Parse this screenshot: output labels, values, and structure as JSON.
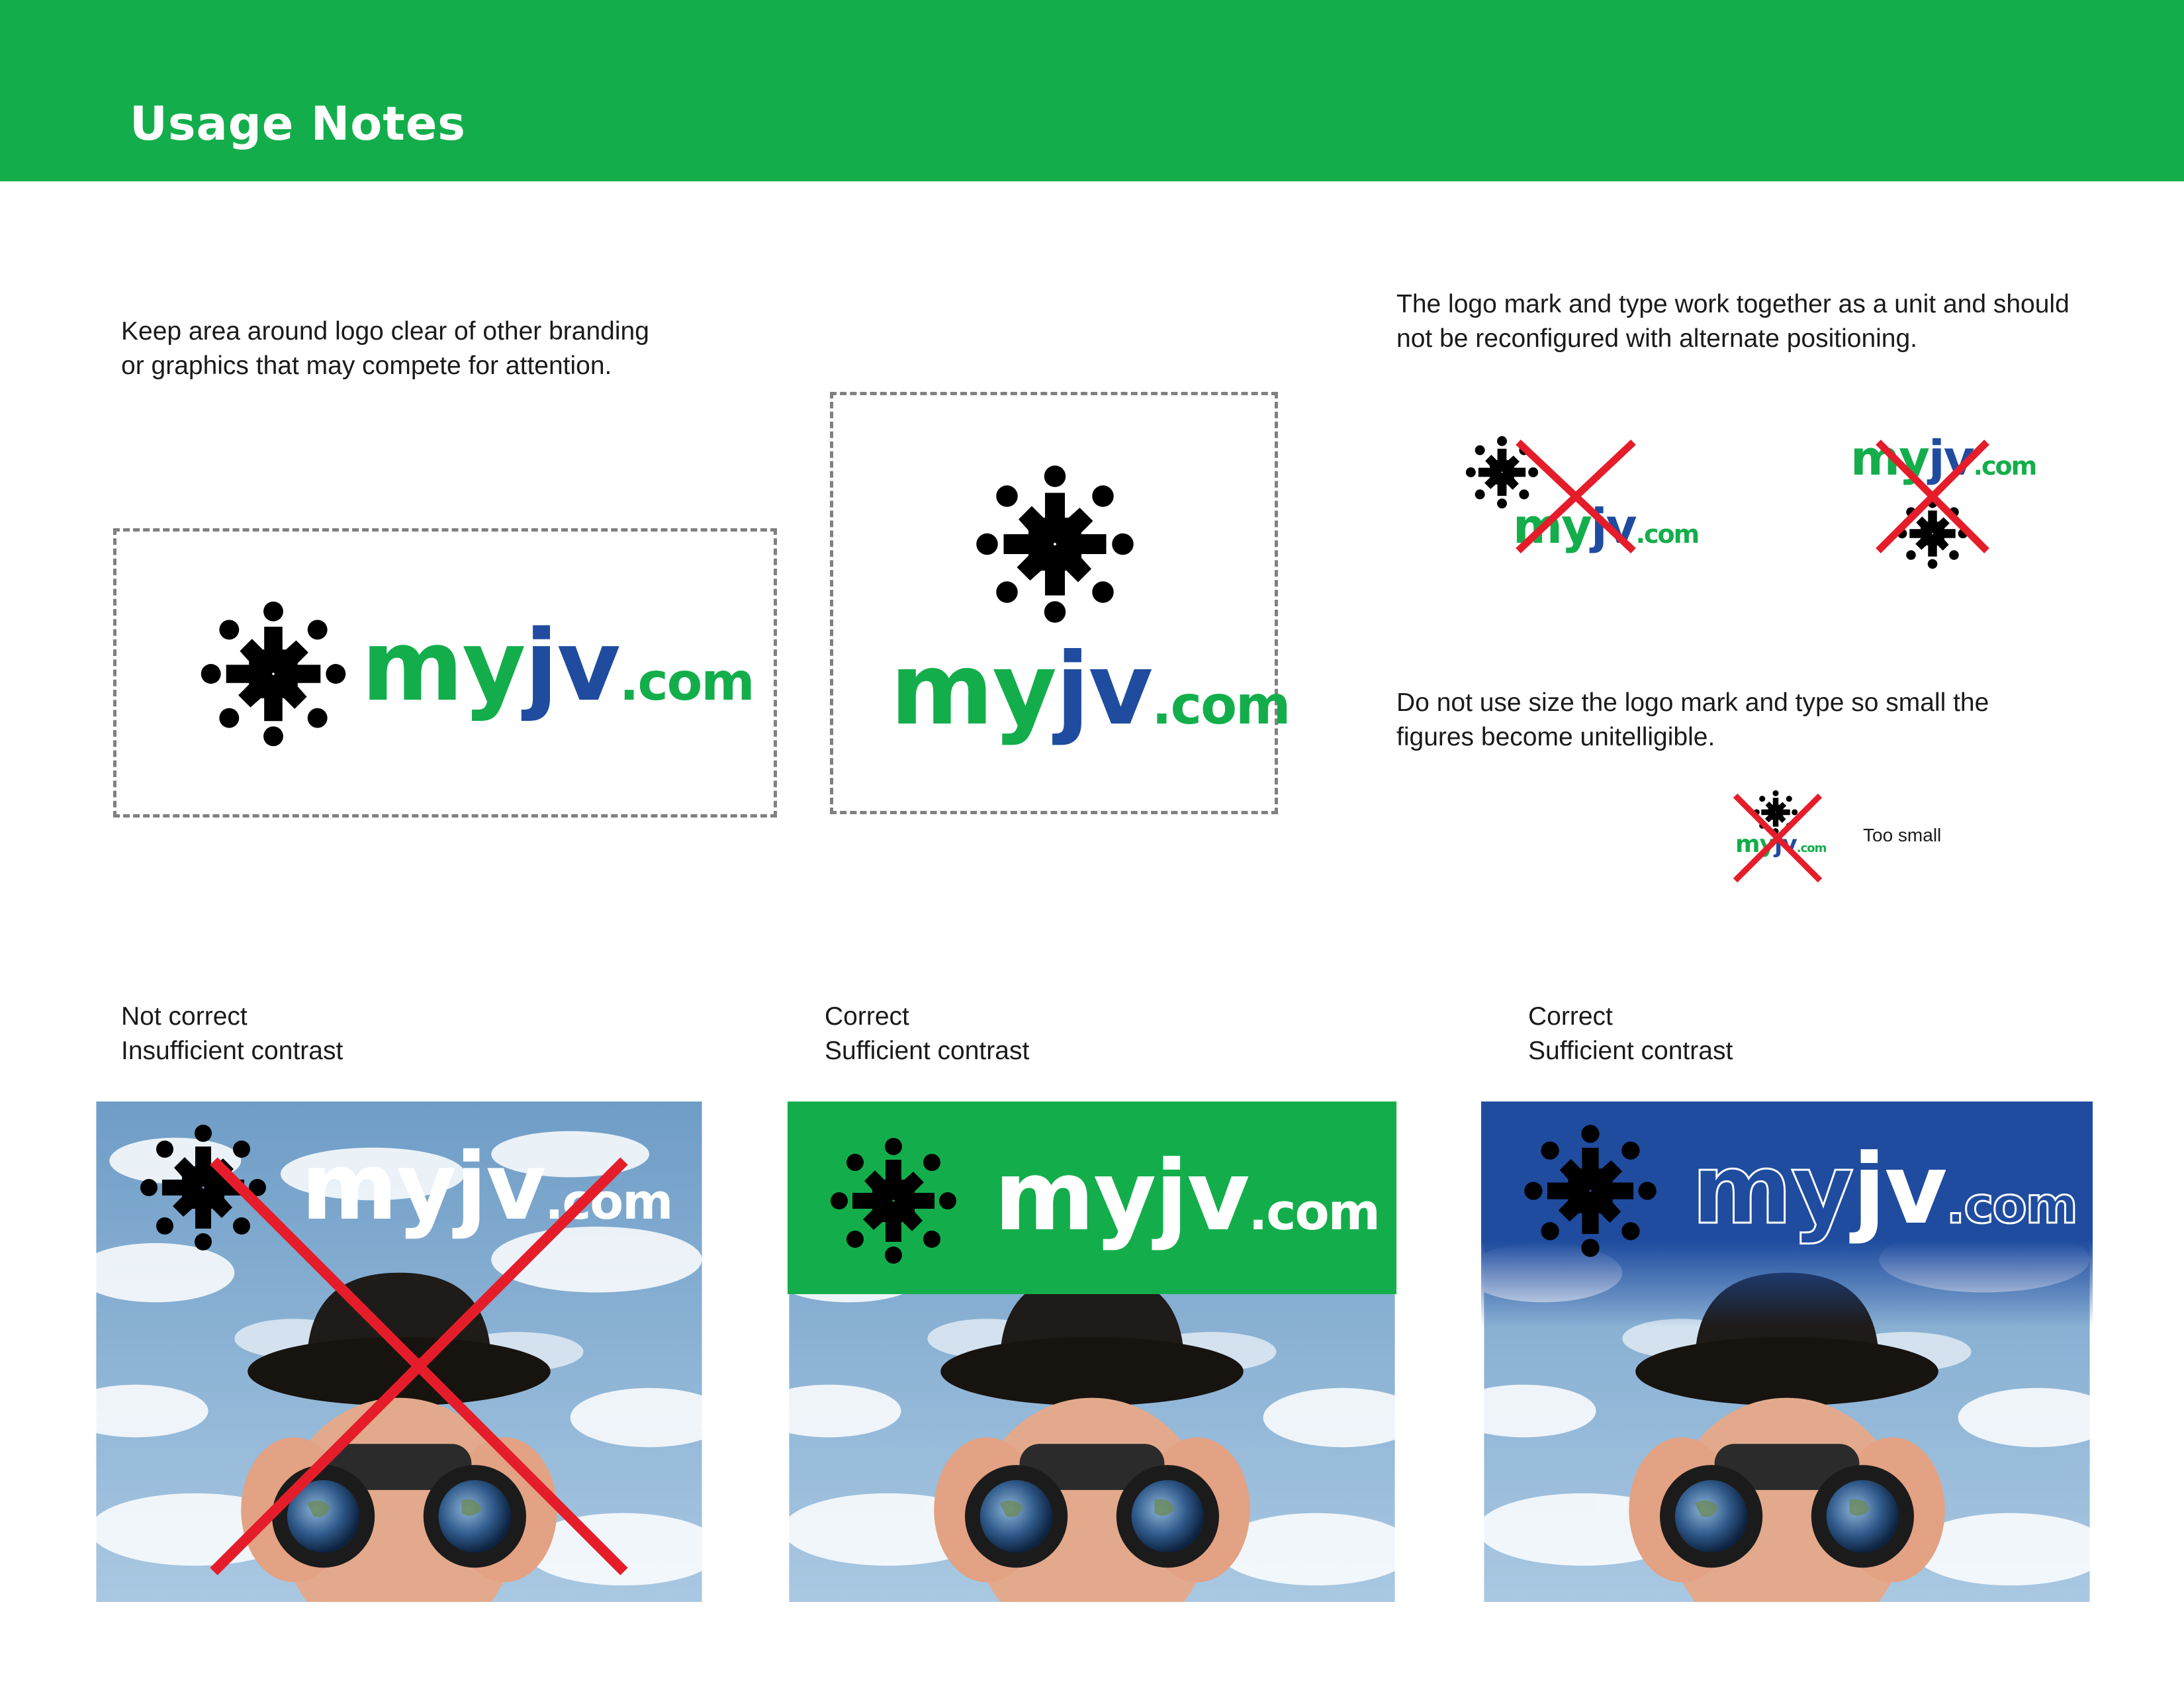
{
  "header": {
    "title": "Usage Notes"
  },
  "colors": {
    "brand_green": "#13ae4b",
    "brand_blue": "#1f4c9f",
    "error_red": "#e51d2a",
    "dash_gray": "#808080"
  },
  "notes": {
    "clear_space": [
      "Keep area around logo clear of other branding",
      "or graphics that may compete for attention."
    ],
    "unit": [
      "The logo mark and type work together as a unit and should",
      "not be reconfigured with  alternate positioning."
    ],
    "size": [
      "Do not use size the logo mark and type so small the",
      "figures become unitelligible."
    ],
    "too_small": "Too small"
  },
  "logo": {
    "my": "my",
    "jv": "jv",
    "com": ".com",
    "icon": "people-circle-logo-icon"
  },
  "examples": [
    {
      "status": "Not correct",
      "reason": "Insufficient contrast"
    },
    {
      "status": "Correct",
      "reason": "Sufficient contrast"
    },
    {
      "status": "Correct",
      "reason": "Sufficient contrast"
    }
  ]
}
